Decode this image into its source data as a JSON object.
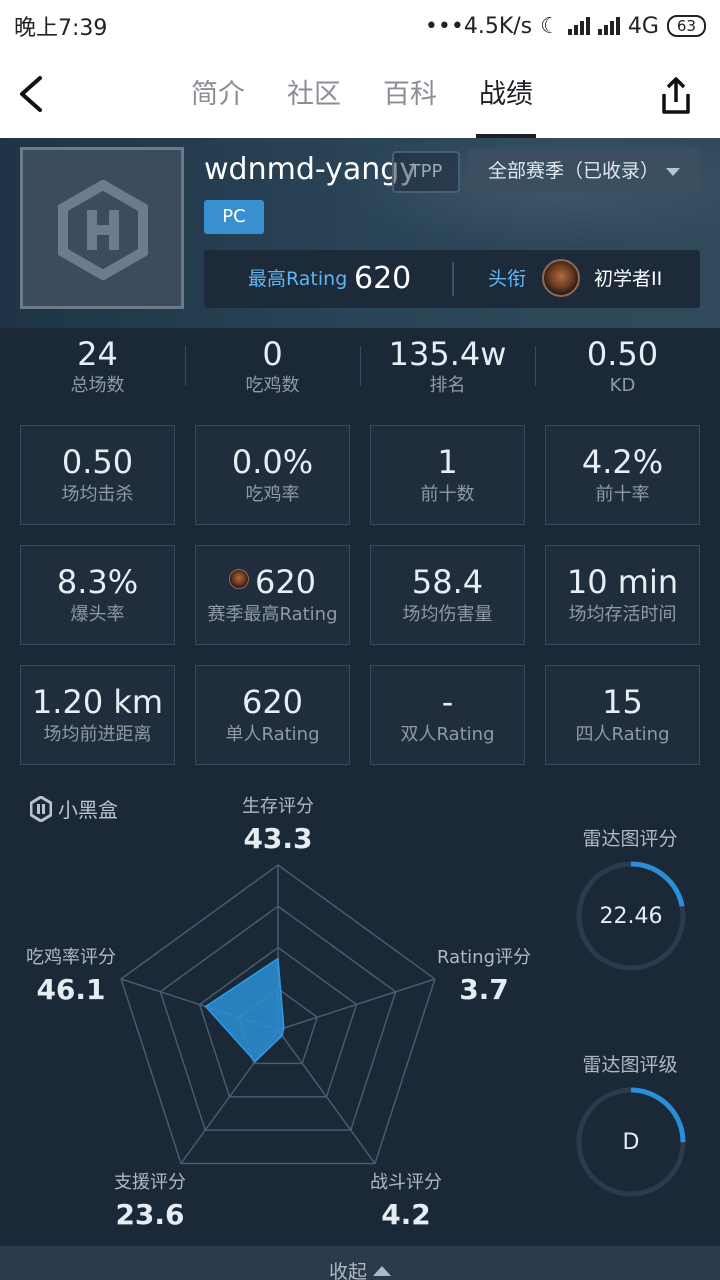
{
  "status_bar": {
    "time": "晚上7:39",
    "speed": "•••4.5K/s",
    "network": "4G",
    "battery": "63"
  },
  "nav": {
    "tabs": [
      {
        "label": "简介",
        "active": false
      },
      {
        "label": "社区",
        "active": false
      },
      {
        "label": "百科",
        "active": false
      },
      {
        "label": "战绩",
        "active": true
      }
    ]
  },
  "profile": {
    "username": "wdnmd-yangyu",
    "mode_tag": "TPP",
    "season_select": "全部赛季（已收录）",
    "platform": "PC",
    "max_rating_label": "最高Rating",
    "max_rating": "620",
    "title_label": "头衔",
    "title_value": "初学者II"
  },
  "overview": [
    {
      "value": "24",
      "label": "总场数"
    },
    {
      "value": "0",
      "label": "吃鸡数"
    },
    {
      "value": "135.4w",
      "label": "排名"
    },
    {
      "value": "0.50",
      "label": "KD"
    }
  ],
  "stats": [
    {
      "value": "0.50",
      "label": "场均击杀"
    },
    {
      "value": "0.0%",
      "label": "吃鸡率"
    },
    {
      "value": "1",
      "label": "前十数"
    },
    {
      "value": "4.2%",
      "label": "前十率"
    },
    {
      "value": "8.3%",
      "label": "爆头率"
    },
    {
      "value": "620",
      "label": "赛季最高Rating"
    },
    {
      "value": "58.4",
      "label": "场均伤害量"
    },
    {
      "value": "10 min",
      "label": "场均存活时间"
    },
    {
      "value": "1.20 km",
      "label": "场均前进距离"
    },
    {
      "value": "620",
      "label": "单人Rating"
    },
    {
      "value": "-",
      "label": "双人Rating"
    },
    {
      "value": "15",
      "label": "四人Rating"
    }
  ],
  "radar": {
    "brand": "小黑盒",
    "max_value": 100,
    "accent_color": "#2a8fd6",
    "axes": [
      {
        "label": "生存评分",
        "value": "43.3"
      },
      {
        "label": "Rating评分",
        "value": "3.7"
      },
      {
        "label": "战斗评分",
        "value": "4.2"
      },
      {
        "label": "支援评分",
        "value": "23.6"
      },
      {
        "label": "吃鸡率评分",
        "value": "46.1"
      }
    ],
    "score_title": "雷达图评分",
    "score_value": "22.46",
    "score_fraction": 0.22,
    "grade_title": "雷达图评级",
    "grade_value": "D",
    "grade_fraction": 0.25
  },
  "collapse_label": "收起"
}
